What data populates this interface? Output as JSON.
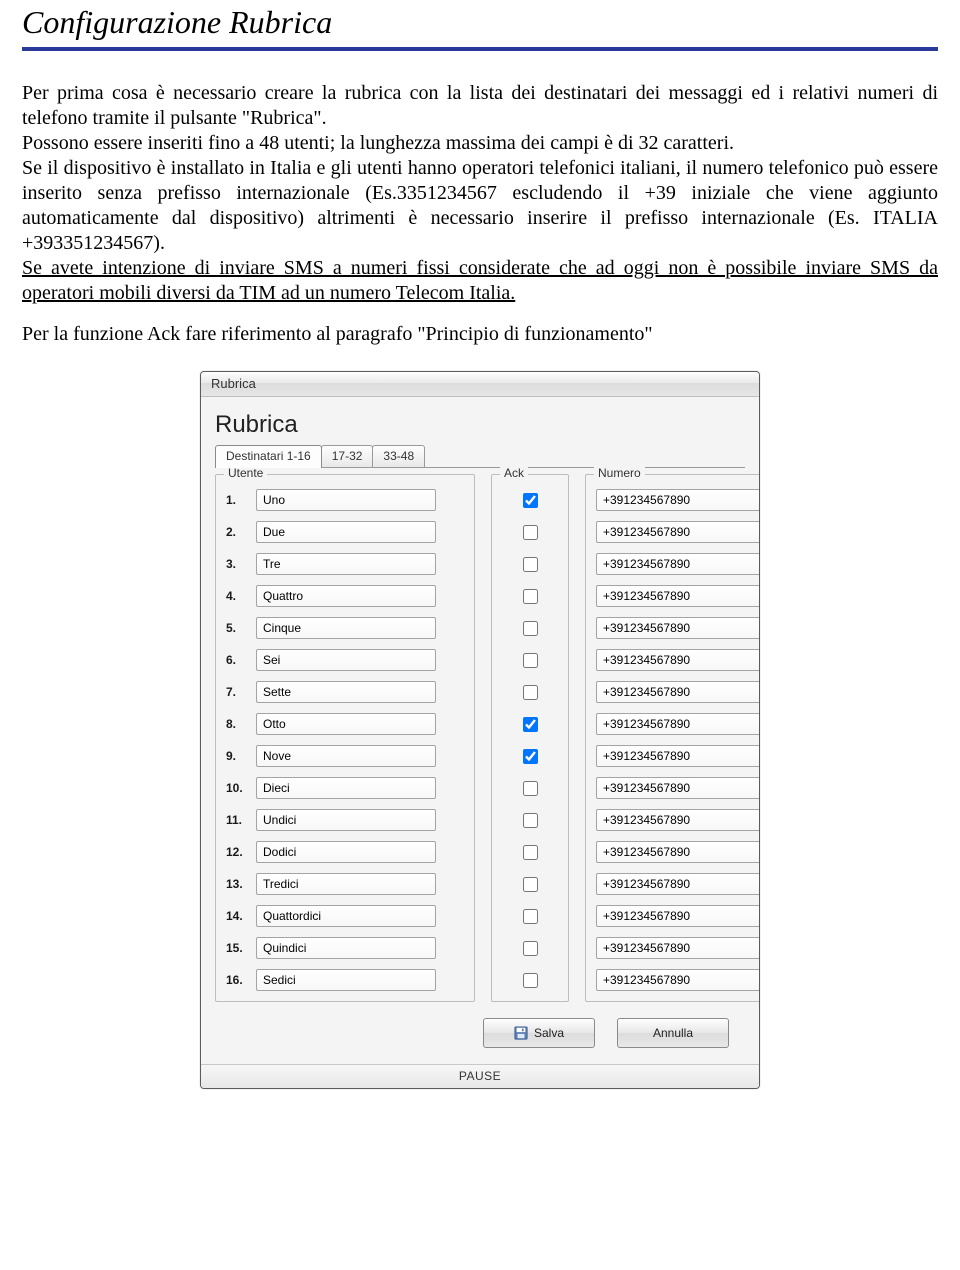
{
  "doc": {
    "title": "Configurazione Rubrica",
    "p1": "Per prima cosa è necessario creare la rubrica con la lista dei destinatari dei messaggi ed i relativi numeri di telefono tramite il pulsante \"Rubrica\".",
    "p2": "Possono essere inseriti fino a 48 utenti; la lunghezza massima dei campi è di 32 caratteri.",
    "p3": "Se il dispositivo è installato in Italia e gli utenti hanno operatori telefonici italiani, il numero telefonico può essere inserito senza prefisso internazionale (Es.3351234567 escludendo il +39 iniziale che viene aggiunto automaticamente dal dispositivo) altrimenti è necessario inserire il prefisso internazionale (Es. ITALIA  +393351234567).",
    "p4_underlined": "Se avete intenzione di inviare SMS a numeri fissi considerate che ad oggi non è possibile inviare SMS da operatori mobili diversi da TIM ad un numero Telecom Italia.",
    "p5": "Per la funzione Ack fare riferimento al paragrafo \"Principio di funzionamento\""
  },
  "dialog": {
    "window_title": "Rubrica",
    "panel_title": "Rubrica",
    "tabs": [
      "Destinatari 1-16",
      "17-32",
      "33-48"
    ],
    "legends": {
      "utente": "Utente",
      "ack": "Ack",
      "numero": "Numero"
    },
    "rows": [
      {
        "n": "1.",
        "utente": "Uno",
        "ack": true,
        "numero": "+391234567890"
      },
      {
        "n": "2.",
        "utente": "Due",
        "ack": false,
        "numero": "+391234567890"
      },
      {
        "n": "3.",
        "utente": "Tre",
        "ack": false,
        "numero": "+391234567890"
      },
      {
        "n": "4.",
        "utente": "Quattro",
        "ack": false,
        "numero": "+391234567890"
      },
      {
        "n": "5.",
        "utente": "Cinque",
        "ack": false,
        "numero": "+391234567890"
      },
      {
        "n": "6.",
        "utente": "Sei",
        "ack": false,
        "numero": "+391234567890"
      },
      {
        "n": "7.",
        "utente": "Sette",
        "ack": false,
        "numero": "+391234567890"
      },
      {
        "n": "8.",
        "utente": "Otto",
        "ack": true,
        "numero": "+391234567890"
      },
      {
        "n": "9.",
        "utente": "Nove",
        "ack": true,
        "numero": "+391234567890"
      },
      {
        "n": "10.",
        "utente": "Dieci",
        "ack": false,
        "numero": "+391234567890"
      },
      {
        "n": "11.",
        "utente": "Undici",
        "ack": false,
        "numero": "+391234567890"
      },
      {
        "n": "12.",
        "utente": "Dodici",
        "ack": false,
        "numero": "+391234567890"
      },
      {
        "n": "13.",
        "utente": "Tredici",
        "ack": false,
        "numero": "+391234567890"
      },
      {
        "n": "14.",
        "utente": "Quattordici",
        "ack": false,
        "numero": "+391234567890"
      },
      {
        "n": "15.",
        "utente": "Quindici",
        "ack": false,
        "numero": "+391234567890"
      },
      {
        "n": "16.",
        "utente": "Sedici",
        "ack": false,
        "numero": "+391234567890"
      }
    ],
    "buttons": {
      "save": "Salva",
      "cancel": "Annulla"
    },
    "status": "PAUSE"
  }
}
